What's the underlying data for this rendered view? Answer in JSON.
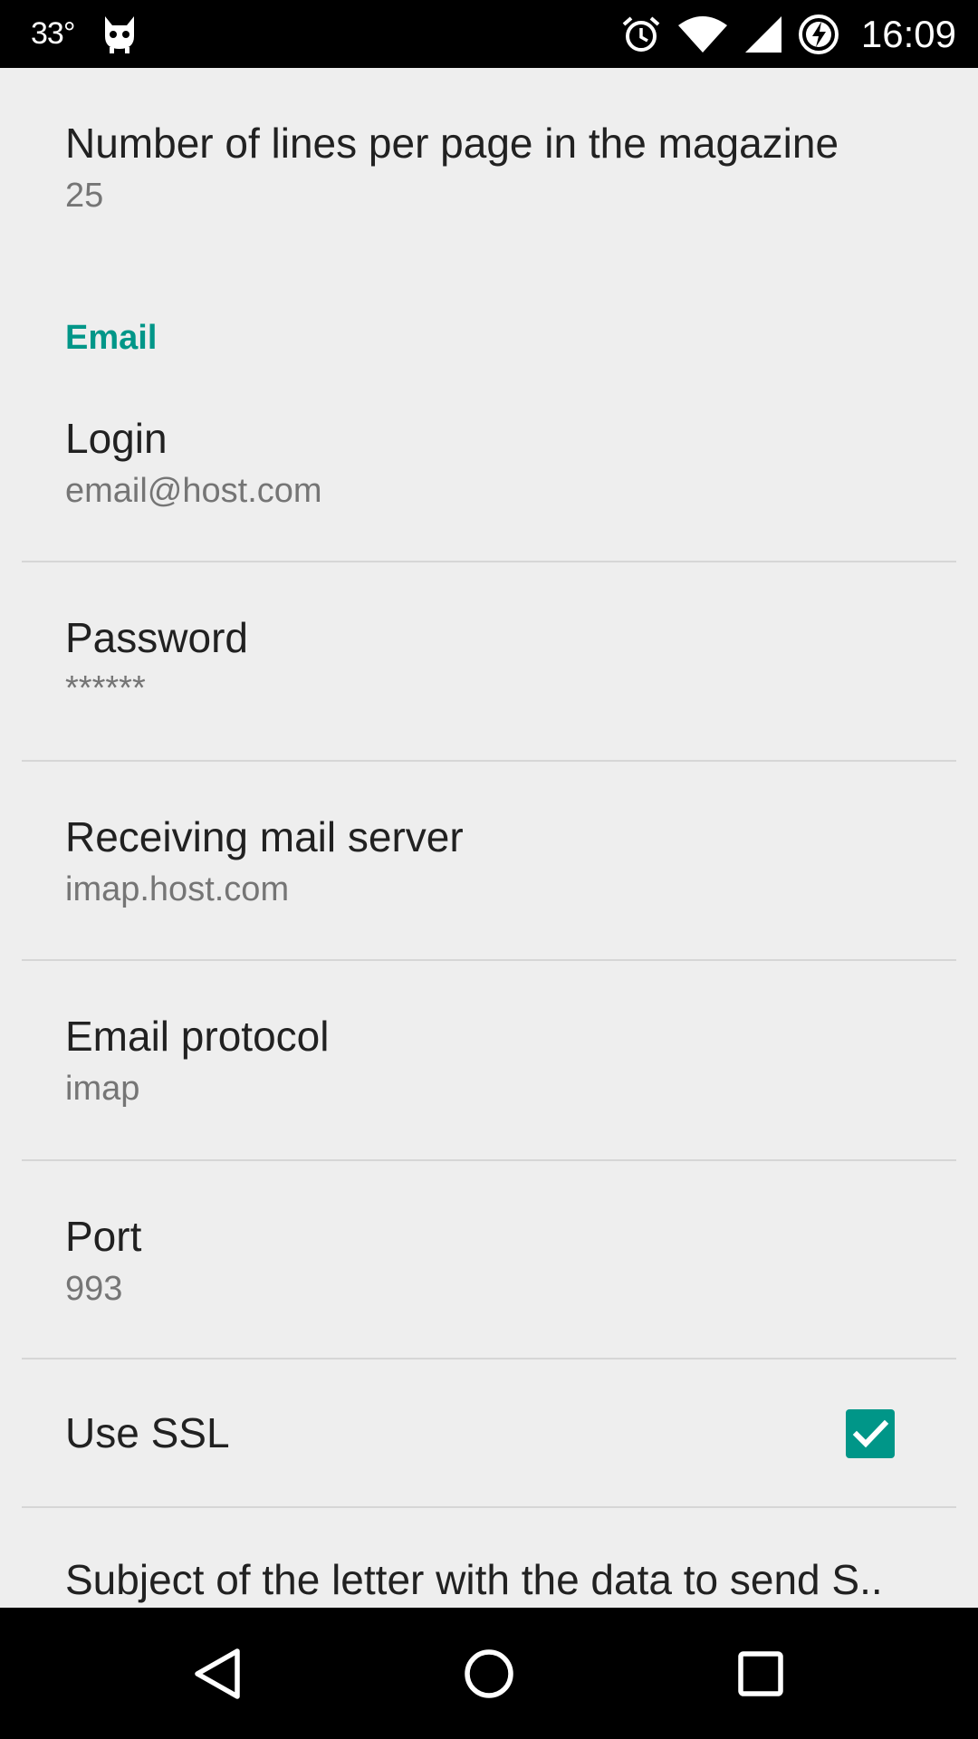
{
  "status_bar": {
    "temperature": "33°",
    "time": "16:09",
    "icons": [
      "cyanogen-mascot-icon",
      "alarm-icon",
      "wifi-icon",
      "cell-signal-icon",
      "battery-charging-icon"
    ]
  },
  "preferences": {
    "lines_per_page": {
      "title": "Number of lines per page in the magazine",
      "summary": "25"
    },
    "email_category": "Email",
    "login": {
      "title": "Login",
      "summary": "email@host.com"
    },
    "password": {
      "title": "Password",
      "summary": "******"
    },
    "server": {
      "title": "Receiving mail server",
      "summary": "imap.host.com"
    },
    "protocol": {
      "title": "Email protocol",
      "summary": "imap"
    },
    "port": {
      "title": "Port",
      "summary": "993"
    },
    "use_ssl": {
      "title": "Use SSL",
      "checked": true
    },
    "subject": {
      "title": "Subject of the letter with the data to send S.."
    }
  },
  "nav_bar": {
    "icons": [
      "back-icon",
      "home-icon",
      "recents-icon"
    ]
  },
  "colors": {
    "accent": "#009688",
    "background": "#eeeeee",
    "title_text": "#212121",
    "summary_text": "#757575"
  }
}
